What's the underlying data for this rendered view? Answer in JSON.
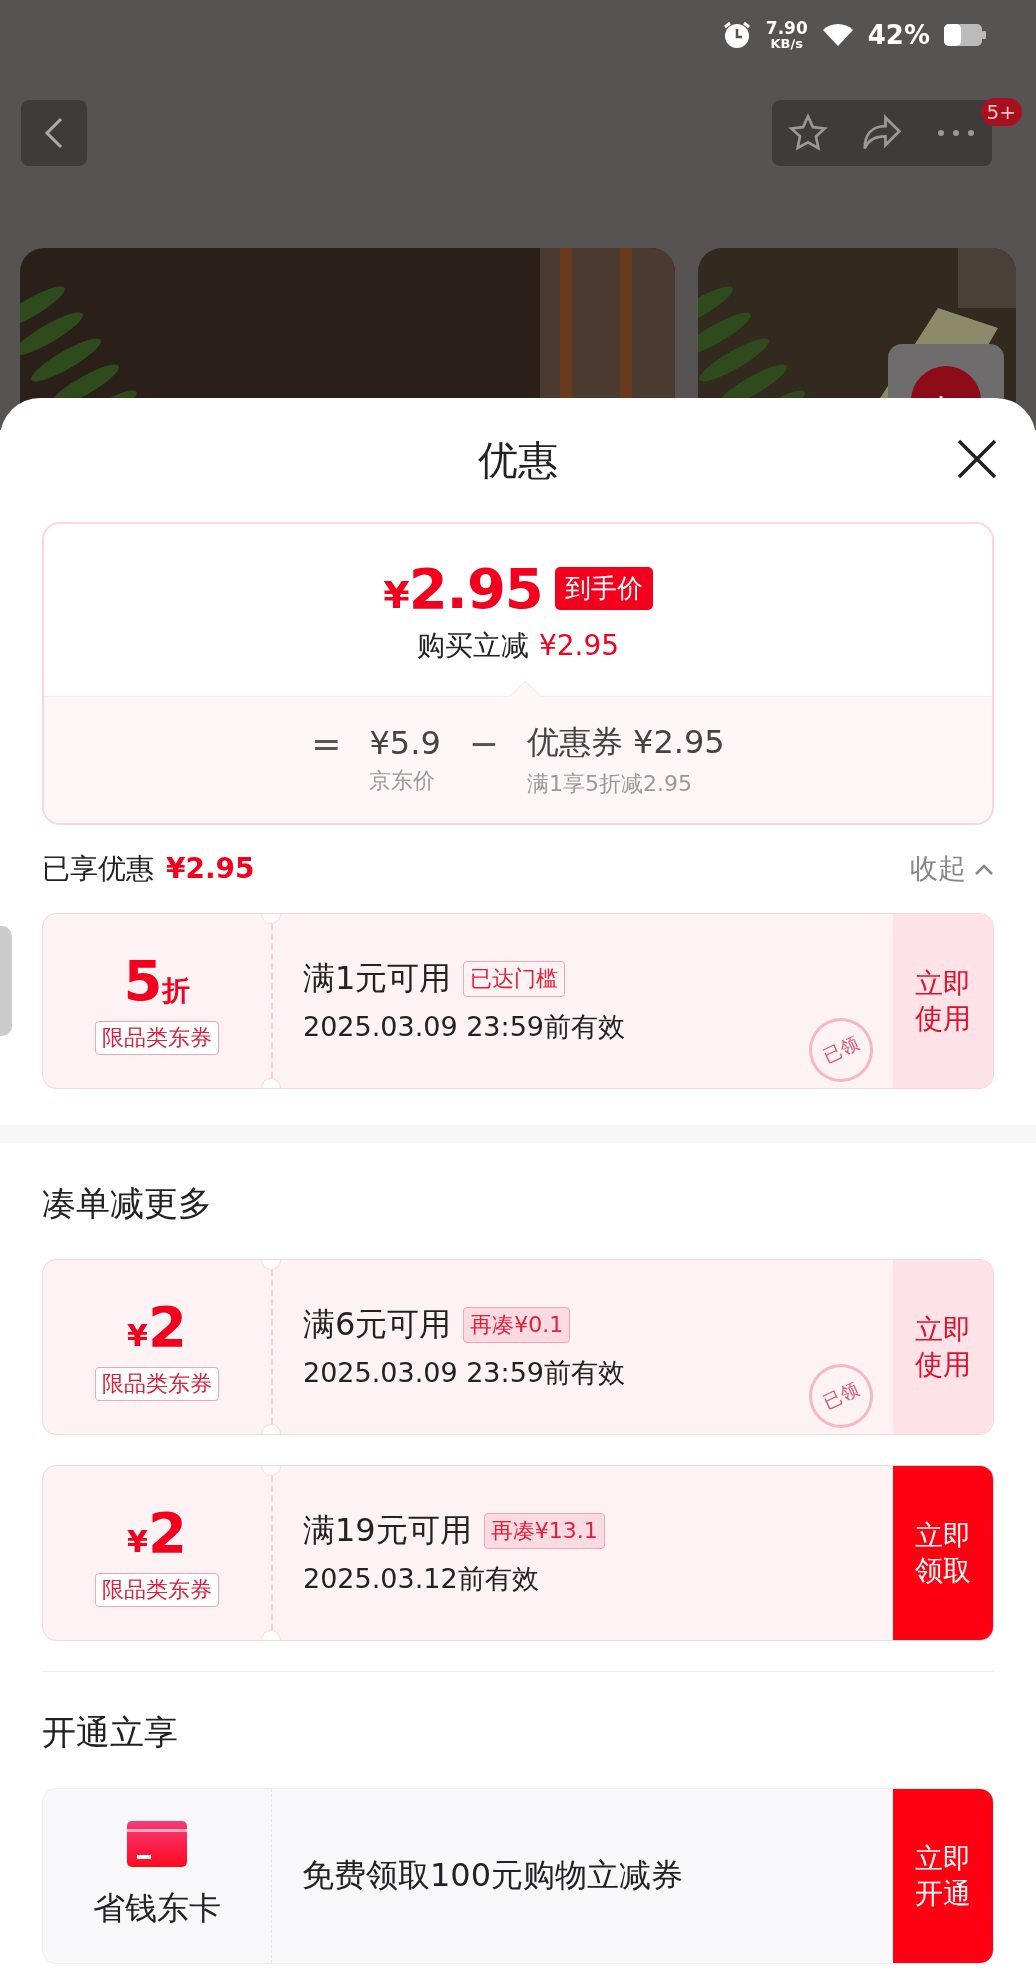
{
  "status_bar": {
    "speed_value": "7.90",
    "speed_unit": "KB/s",
    "battery": "42%"
  },
  "nav": {
    "badge": "5+"
  },
  "sheet": {
    "title": "优惠"
  },
  "price_card": {
    "currency": "¥",
    "final_price": "2.95",
    "final_label": "到手价",
    "instant_label": "购买立减",
    "instant_amount": "¥2.95",
    "equation": [
      {
        "kind": "operator",
        "text": "="
      },
      {
        "kind": "term",
        "value": "¥5.9",
        "caption": "京东价"
      },
      {
        "kind": "operator",
        "text": "−"
      },
      {
        "kind": "term",
        "value": "优惠券 ¥2.95",
        "caption": "满1享5折减2.95"
      }
    ]
  },
  "enjoyed": {
    "label": "已享优惠",
    "amount": "¥2.95",
    "toggle": "收起",
    "expanded": true
  },
  "sections": [
    {
      "coupons": [
        {
          "kind": "discount",
          "value": "5",
          "unit": "折",
          "scope": "限品类东券",
          "condition": "满1元可用",
          "tag": "已达门槛",
          "date": "2025.03.09 23:59前有效",
          "action": "立即使用",
          "claimed": true,
          "stamp": "已领"
        }
      ]
    },
    {
      "title": "凑单减更多",
      "coupons": [
        {
          "kind": "cash",
          "value": "2",
          "unit": "¥",
          "scope": "限品类东券",
          "condition": "满6元可用",
          "tag": "再凑¥0.1",
          "date": "2025.03.09 23:59前有效",
          "action": "立即使用",
          "claimed": true,
          "stamp": "已领"
        },
        {
          "kind": "cash",
          "value": "2",
          "unit": "¥",
          "scope": "限品类东券",
          "condition": "满19元可用",
          "tag": "再凑¥13.1",
          "date": "2025.03.12前有效",
          "action": "立即领取",
          "claimed": false
        }
      ]
    }
  ],
  "membership": {
    "title": "开通立享",
    "name": "省钱东卡",
    "description": "免费领取100元购物立减券",
    "action": "立即开通"
  }
}
